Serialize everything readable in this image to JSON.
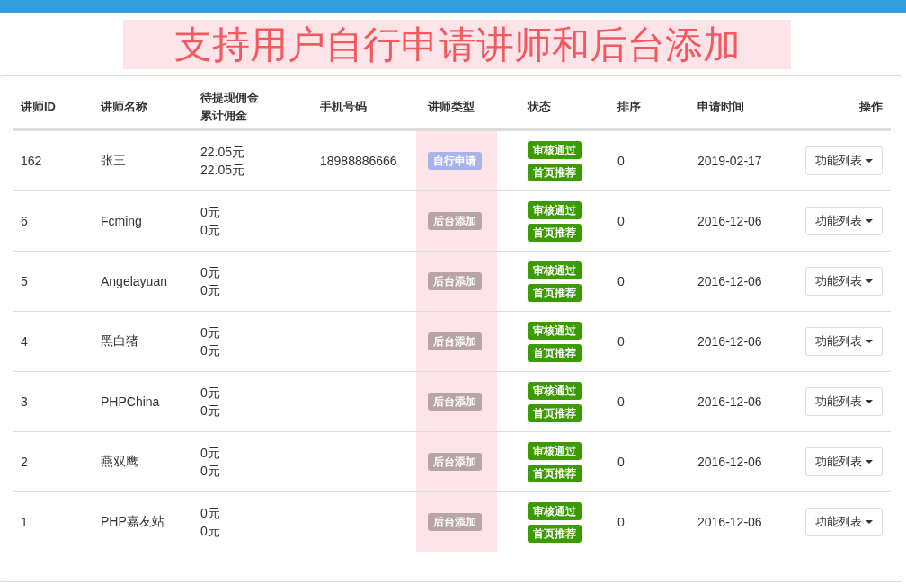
{
  "banner": {
    "title": "支持用户自行申请讲师和后台添加"
  },
  "table": {
    "columns": [
      [
        "讲师ID"
      ],
      [
        "讲师名称"
      ],
      [
        "待提现佣金",
        "累计佣金"
      ],
      [
        "手机号码"
      ],
      [
        "讲师类型"
      ],
      [
        "状态"
      ],
      [
        "排序"
      ],
      [
        "申请时间"
      ],
      [
        "操作"
      ]
    ],
    "rows": [
      {
        "id": "162",
        "name": "张三",
        "commission_pending": "22.05元",
        "commission_total": "22.05元",
        "phone": "18988886666",
        "type": {
          "label": "自行申请",
          "kind": "self"
        },
        "statuses": [
          "审核通过",
          "首页推荐"
        ],
        "sort": "0",
        "date": "2019-02-17",
        "action": "功能列表"
      },
      {
        "id": "6",
        "name": "Fcming",
        "commission_pending": "0元",
        "commission_total": "0元",
        "type": {
          "label": "后台添加",
          "kind": "admin"
        },
        "statuses": [
          "审核通过",
          "首页推荐"
        ],
        "sort": "0",
        "date": "2016-12-06",
        "action": "功能列表"
      },
      {
        "id": "5",
        "name": "Angelayuan",
        "commission_pending": "0元",
        "commission_total": "0元",
        "type": {
          "label": "后台添加",
          "kind": "admin"
        },
        "statuses": [
          "审核通过",
          "首页推荐"
        ],
        "sort": "0",
        "date": "2016-12-06",
        "action": "功能列表"
      },
      {
        "id": "4",
        "name": "黑白猪",
        "commission_pending": "0元",
        "commission_total": "0元",
        "type": {
          "label": "后台添加",
          "kind": "admin"
        },
        "statuses": [
          "审核通过",
          "首页推荐"
        ],
        "sort": "0",
        "date": "2016-12-06",
        "action": "功能列表"
      },
      {
        "id": "3",
        "name": "PHPChina",
        "commission_pending": "0元",
        "commission_total": "0元",
        "type": {
          "label": "后台添加",
          "kind": "admin"
        },
        "statuses": [
          "审核通过",
          "首页推荐"
        ],
        "sort": "0",
        "date": "2016-12-06",
        "action": "功能列表"
      },
      {
        "id": "2",
        "name": "燕双鹰",
        "commission_pending": "0元",
        "commission_total": "0元",
        "type": {
          "label": "后台添加",
          "kind": "admin"
        },
        "statuses": [
          "审核通过",
          "首页推荐"
        ],
        "sort": "0",
        "date": "2016-12-06",
        "action": "功能列表"
      },
      {
        "id": "1",
        "name": "PHP嘉友站",
        "commission_pending": "0元",
        "commission_total": "0元",
        "type": {
          "label": "后台添加",
          "kind": "admin"
        },
        "statuses": [
          "审核通过",
          "首页推荐"
        ],
        "sort": "0",
        "date": "2016-12-06",
        "action": "功能列表"
      }
    ]
  }
}
